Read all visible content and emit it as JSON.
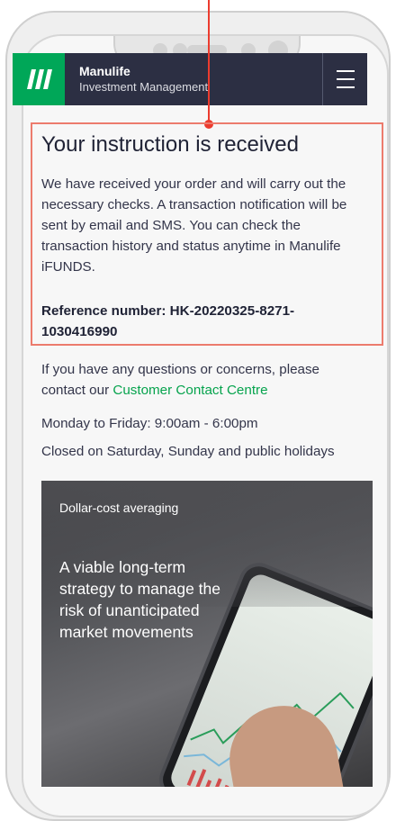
{
  "header": {
    "brand_title": "Manulife",
    "brand_subtitle": "Investment Management"
  },
  "confirmation": {
    "title": "Your instruction is received",
    "message": "We have received your order and will carry out the necessary checks. A transaction notification will be sent by email and SMS. You can check the transaction history and status anytime in Manulife iFUNDS.",
    "reference_label": "Reference number: HK-20220325-8271-1030416990"
  },
  "contact": {
    "text_prefix": "If you have any questions or concerns, please contact our ",
    "link_text": "Customer Contact Centre"
  },
  "hours": {
    "weekdays": "Monday to Friday: 9:00am - 6:00pm",
    "closed": "Closed on Saturday, Sunday and public holidays"
  },
  "promo": {
    "tag": "Dollar-cost averaging",
    "headline": "A viable long-term strategy to manage the risk of unanticipated market movements"
  },
  "colors": {
    "brand_green": "#00a758",
    "header_bg": "#2c2f43",
    "link_green": "#06a34d",
    "highlight_border": "#ec7b6d",
    "pointer_red": "#ec3b2e"
  }
}
